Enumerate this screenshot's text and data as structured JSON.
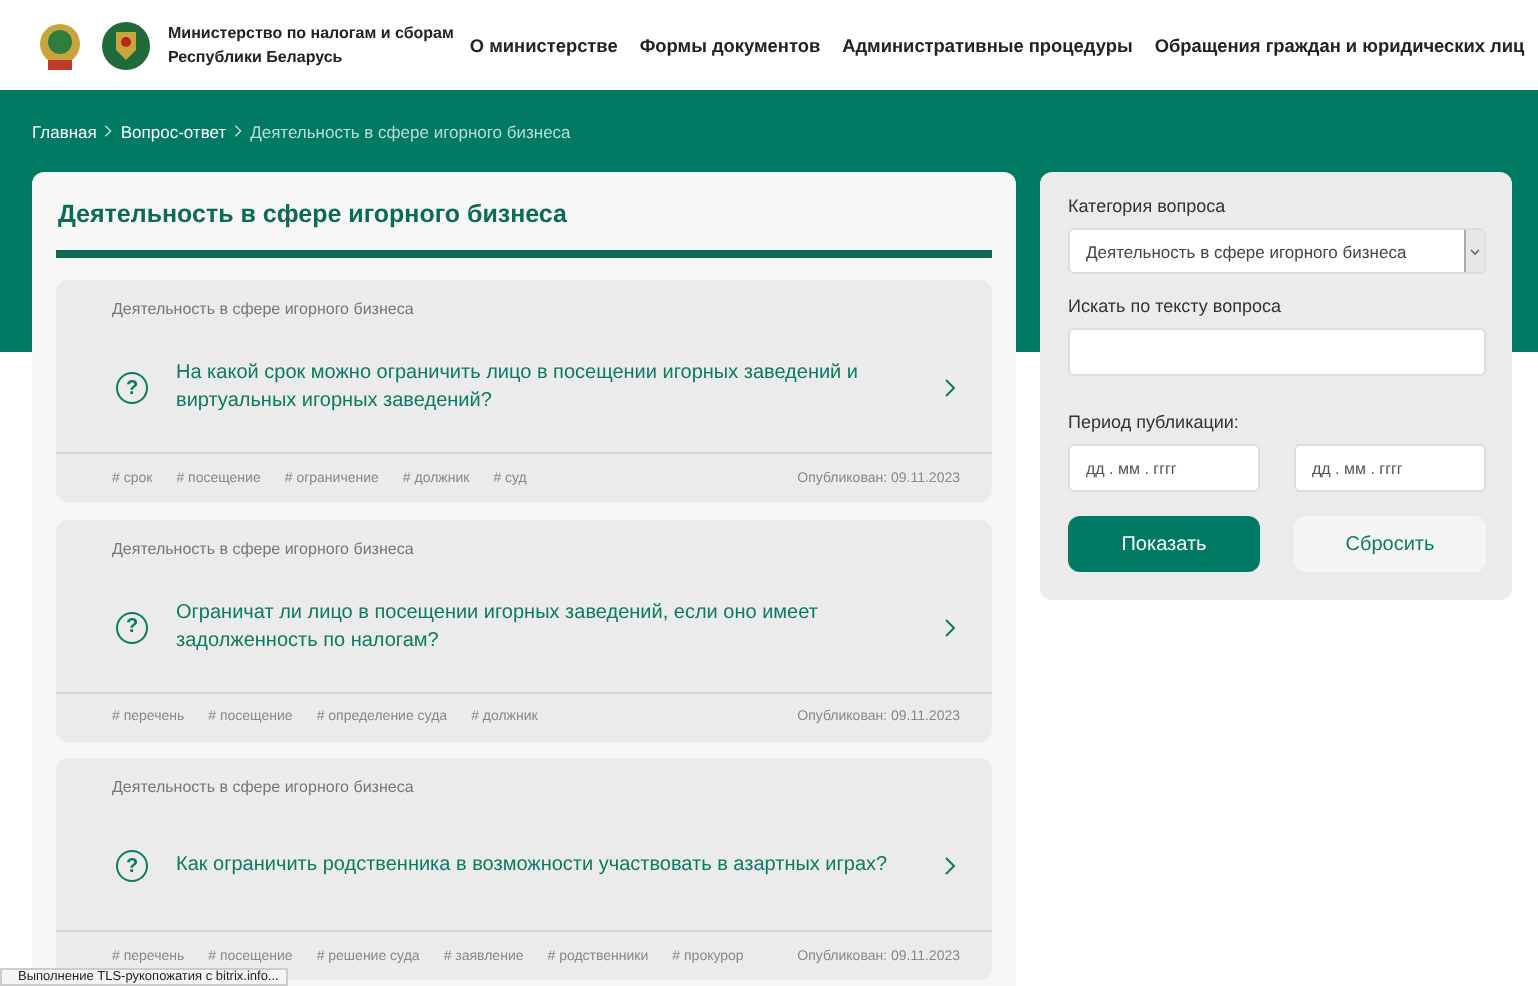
{
  "header": {
    "org_name": [
      "Министерство по налогам и сборам",
      "Республики Беларусь"
    ],
    "nav": [
      "О министерстве",
      "Формы документов",
      "Административные процедуры",
      "Обращения граждан и юридических лиц"
    ]
  },
  "breadcrumbs": [
    {
      "label": "Главная",
      "current": false
    },
    {
      "label": "Вопрос-ответ",
      "current": false
    },
    {
      "label": "Деятельность в сфере игорного бизнеса",
      "current": true
    }
  ],
  "section_title": "Деятельность в сфере игорного бизнеса",
  "questions": [
    {
      "category": "Деятельность в сфере игорного бизнеса",
      "marker": "?",
      "question": "На какой срок можно ограничить лицо в посещении игорных заведений и виртуальных игорных заведений?",
      "tags": [
        "# срок",
        "# посещение",
        "# ограничение",
        "# должник",
        "# суд"
      ],
      "published": "Опубликован: 09.11.2023"
    },
    {
      "category": "Деятельность в сфере игорного бизнеса",
      "marker": "?",
      "question": "Ограничат ли лицо в посещении игорных заведений, если оно имеет задолженность по налогам?",
      "tags": [
        "# перечень",
        "# посещение",
        "# определение суда",
        "# должник"
      ],
      "published": "Опубликован: 09.11.2023"
    },
    {
      "category": "Деятельность в сфере игорного бизнеса",
      "marker": "?",
      "question": "Как ограничить родственника в возможности участвовать в азартных играх?",
      "tags": [
        "# перечень",
        "# посещение",
        "# решение суда",
        "# заявление",
        "# родственники",
        "# прокурор"
      ],
      "published": "Опубликован: 09.11.2023"
    }
  ],
  "filter": {
    "category_label": "Категория вопроса",
    "category_value": "Деятельность в сфере игорного бизнеса",
    "search_label": "Искать по тексту вопроса",
    "period_label": "Период публикации:",
    "date_from_placeholder": "дд . мм . гггг",
    "date_to_placeholder": "дд . мм . гггг",
    "show_button": "Показать",
    "reset_button": "Сбросить"
  },
  "status_bar": "Выполнение TLS-рукопожатия с bitrix.info..."
}
